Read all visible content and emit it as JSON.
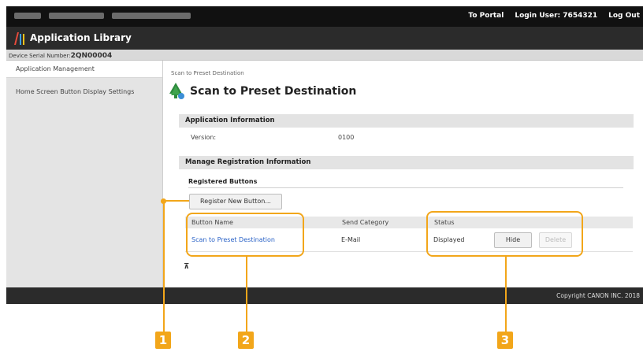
{
  "topbar": {
    "portal_link": "To Portal",
    "login_label": "Login User:",
    "login_user": "7654321",
    "logout_link": "Log Out"
  },
  "app": {
    "title": "Application Library"
  },
  "device": {
    "serial_label": "Device Serial Number:",
    "serial_value": "2QN00004"
  },
  "sidebar": {
    "items": [
      {
        "label": "Application Management",
        "active": true
      },
      {
        "label": "Home Screen Button Display Settings",
        "active": false
      }
    ]
  },
  "main": {
    "breadcrumb": "Scan to Preset Destination",
    "title": "Scan to Preset Destination",
    "app_info": {
      "heading": "Application Information",
      "version_label": "Version:",
      "version_value": "0100"
    },
    "manage": {
      "heading": "Manage Registration Information",
      "subheading": "Registered Buttons",
      "register_button": "Register New Button...",
      "columns": [
        "Button Name",
        "Send Category",
        "Status"
      ],
      "rows": [
        {
          "button_name": "Scan to Preset Destination",
          "send_category": "E-Mail",
          "status": "Displayed",
          "hide_label": "Hide",
          "delete_label": "Delete"
        }
      ]
    }
  },
  "footer": {
    "copyright": "Copyright CANON INC. 2018"
  },
  "callouts": [
    "1",
    "2",
    "3"
  ],
  "colors": {
    "accent": "#f2a61a",
    "link": "#2b63c7",
    "header": "#2b2b2b"
  }
}
